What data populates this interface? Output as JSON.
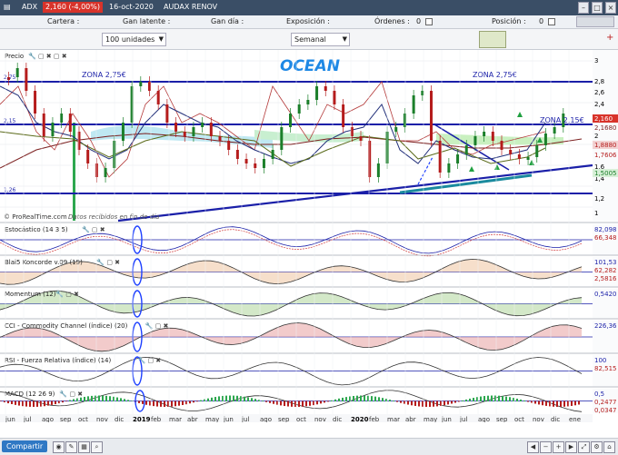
{
  "titlebar": {
    "symbol": "ADX",
    "price_change": "2,160 (-4,00%)",
    "date": "16-oct-2020",
    "name": "AUDAX RENOV"
  },
  "infobar": {
    "cartera": "Cartera :",
    "gan_latente": "Gan latente :",
    "gan_dia": "Gan día :",
    "exposicion": "Exposición :",
    "ordenes": "Órdenes :",
    "ordenes_val": "0",
    "posicion": "Posición :",
    "posicion_val": "0"
  },
  "toolbar": {
    "units": "100 unidades",
    "timeframe": "Semanal"
  },
  "price_panel": {
    "label": "Precio",
    "watermark": "OCEAN",
    "zone_left": "ZONA 2,75€",
    "zone_right": "ZONA 2,75€",
    "zone_mid": "ZONA 2,15€",
    "credit": "© ProRealTime.com",
    "credit2": "Datos recibidos en fin de día",
    "axis": [
      "3",
      "2,8",
      "2,6",
      "2,4",
      "2,2",
      "2",
      "1,8",
      "1,6",
      "1,4",
      "1,2",
      "1"
    ],
    "tags": [
      "2,160",
      "2,1680",
      "1,8880",
      "1,7606",
      "1,5005"
    ],
    "left_tags": [
      "2,75",
      "2,15",
      "1,26"
    ]
  },
  "panels": [
    {
      "label": "Estocástico (14 3 5)",
      "values": [
        "82,098",
        "66,348"
      ]
    },
    {
      "label": "Blai5 Koncorde v.09 (15)",
      "values": [
        "101,53",
        "62,282",
        "2,5816"
      ]
    },
    {
      "label": "Momentum (12)",
      "values": [
        "0,5420"
      ]
    },
    {
      "label": "CCI - Commodity Channel (índice) (20)",
      "values": [
        "226,36"
      ]
    },
    {
      "label": "RSI - Fuerza Relativa (índice) (14)",
      "values": [
        "100",
        "82,515"
      ]
    },
    {
      "label": "MACD (12 26 9)",
      "values": [
        "0,5",
        "0,2477",
        "0,0347"
      ]
    }
  ],
  "xaxis": [
    "jun",
    "jul",
    "ago",
    "sep",
    "oct",
    "nov",
    "dic",
    "2019",
    "feb",
    "mar",
    "abr",
    "may",
    "jun",
    "jul",
    "ago",
    "sep",
    "oct",
    "nov",
    "dic",
    "2020",
    "feb",
    "mar",
    "abr",
    "may",
    "jun",
    "jul",
    "ago",
    "sep",
    "oct",
    "nov",
    "dic",
    "ene"
  ],
  "bottom": {
    "share": "Compartir"
  },
  "colors": {
    "titlebar": "#3a4e66",
    "zone_line": "#1a1fa8",
    "watermark": "#1e88e5",
    "up": "#1b7f2a",
    "down": "#b51c1c"
  }
}
